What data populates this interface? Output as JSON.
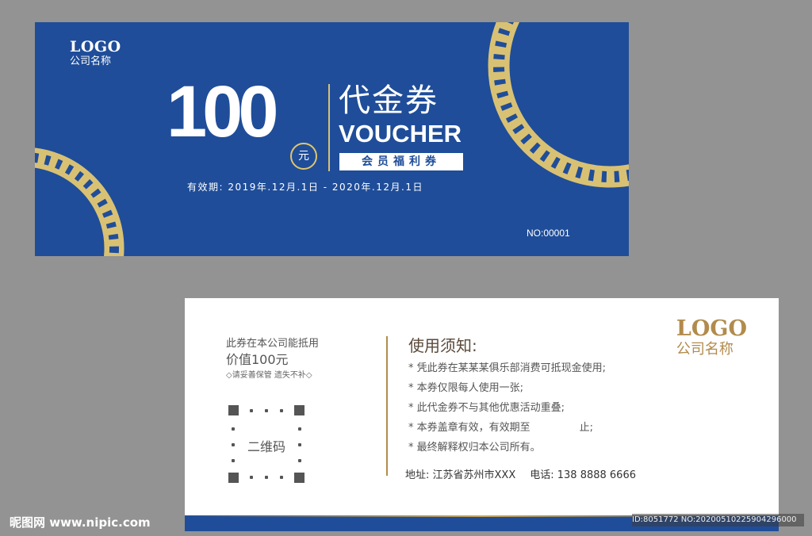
{
  "colors": {
    "background": "#939393",
    "brand_blue": "#1f4d99",
    "gold": "#d9c174",
    "dark_gold": "#b28b4c"
  },
  "front": {
    "logo": "LOGO",
    "company": "公司名称",
    "amount": "100",
    "currency": "元",
    "title_cn": "代金券",
    "title_en": "VOUCHER",
    "member_label": "会员福利券",
    "validity": "有效期: 2019年.12月.1日 - 2020年.12月.1日",
    "serial": "NO:00001"
  },
  "back": {
    "credit_line1": "此券在本公司能抵用",
    "credit_line2": "价值100元",
    "keep_note": "◇请妥善保管 遗失不补◇",
    "qr_label": "二维码",
    "notice_title": "使用须知:",
    "notices": [
      "* 凭此券在某某某俱乐部消费可抵现金使用;",
      "* 本券仅限每人使用一张;",
      "* 此代金券不与其他优惠活动重叠;",
      "* 本券盖章有效，有效期至               止;",
      "* 最终解释权归本公司所有。"
    ],
    "address": "地址: 江苏省苏州市XXX",
    "phone": "电话: 138 8888 6666",
    "logo": "LOGO",
    "company": "公司名称"
  },
  "watermark": {
    "site": "昵图网 www.nipic.com",
    "id": "ID:8051772 NO:20200510225904296000"
  }
}
